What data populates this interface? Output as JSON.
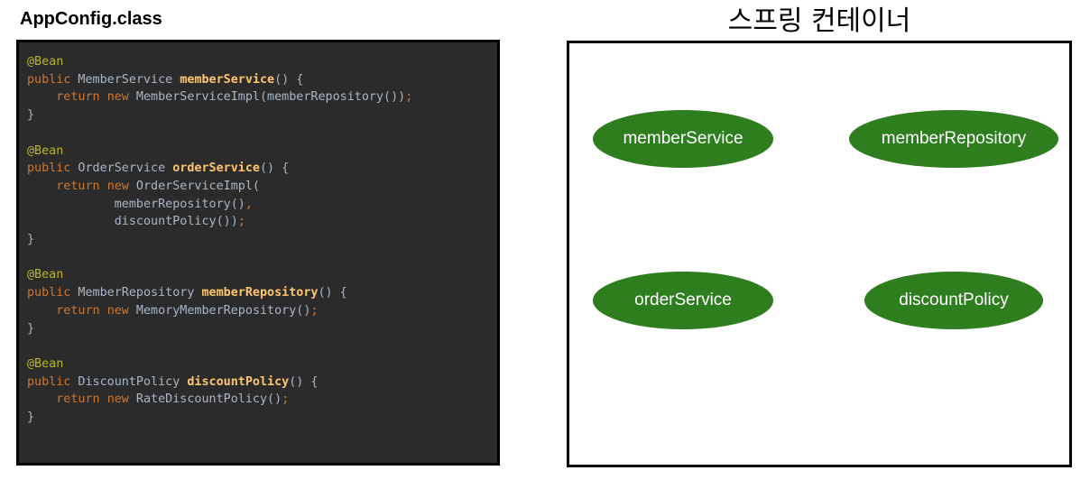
{
  "code_title": "AppConfig.class",
  "container_title": "스프링 컨테이너",
  "code": {
    "annotation": "@Bean",
    "kw_public": "public",
    "kw_return": "return",
    "kw_new": "new",
    "member_service": {
      "return_type": " MemberService ",
      "method": "memberService",
      "params_open": "() {",
      "body": " MemberServiceImpl(memberRepository())",
      "semi": ";",
      "close": "}"
    },
    "order_service": {
      "return_type": " OrderService ",
      "method": "orderService",
      "params_open": "() {",
      "body_open": " OrderServiceImpl(",
      "arg1": "memberRepository()",
      "comma": ",",
      "arg2": "discountPolicy())",
      "semi": ";",
      "close": "}"
    },
    "member_repository": {
      "return_type": " MemberRepository ",
      "method": "memberRepository",
      "params_open": "() {",
      "body": " MemoryMemberRepository()",
      "semi": ";",
      "close": "}"
    },
    "discount_policy": {
      "return_type": " DiscountPolicy ",
      "method": "discountPolicy",
      "params_open": "() {",
      "body": " RateDiscountPolicy()",
      "semi": ";",
      "close": "}"
    }
  },
  "beans": {
    "member_service": "memberService",
    "member_repository": "memberRepository",
    "order_service": "orderService",
    "discount_policy": "discountPolicy"
  },
  "colors": {
    "code_background": "#2b2b2b",
    "bean_fill": "#2e7d1f",
    "annotation": "#bbb529",
    "keyword": "#cc7832",
    "method_name": "#ffc66d",
    "plain_code": "#a9b7c6"
  }
}
